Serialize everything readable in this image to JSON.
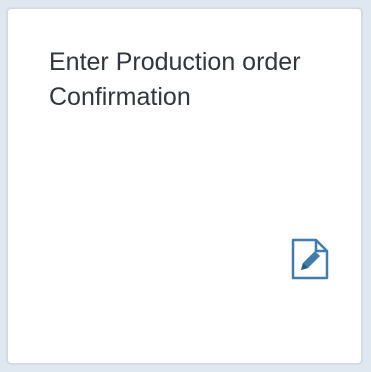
{
  "tile": {
    "title": "Enter Production order Confirmation",
    "icon": "edit-document-icon",
    "accent_color": "#427cac"
  }
}
